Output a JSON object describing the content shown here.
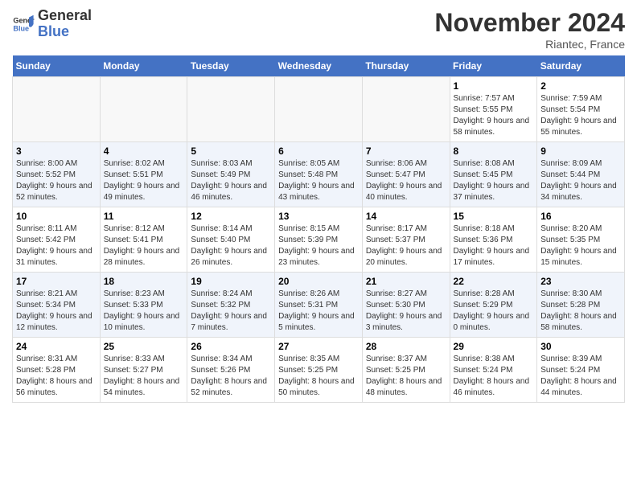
{
  "header": {
    "logo_line1": "General",
    "logo_line2": "Blue",
    "title": "November 2024",
    "subtitle": "Riantec, France"
  },
  "weekdays": [
    "Sunday",
    "Monday",
    "Tuesday",
    "Wednesday",
    "Thursday",
    "Friday",
    "Saturday"
  ],
  "weeks": [
    [
      {
        "day": "",
        "detail": ""
      },
      {
        "day": "",
        "detail": ""
      },
      {
        "day": "",
        "detail": ""
      },
      {
        "day": "",
        "detail": ""
      },
      {
        "day": "",
        "detail": ""
      },
      {
        "day": "1",
        "detail": "Sunrise: 7:57 AM\nSunset: 5:55 PM\nDaylight: 9 hours and 58 minutes."
      },
      {
        "day": "2",
        "detail": "Sunrise: 7:59 AM\nSunset: 5:54 PM\nDaylight: 9 hours and 55 minutes."
      }
    ],
    [
      {
        "day": "3",
        "detail": "Sunrise: 8:00 AM\nSunset: 5:52 PM\nDaylight: 9 hours and 52 minutes."
      },
      {
        "day": "4",
        "detail": "Sunrise: 8:02 AM\nSunset: 5:51 PM\nDaylight: 9 hours and 49 minutes."
      },
      {
        "day": "5",
        "detail": "Sunrise: 8:03 AM\nSunset: 5:49 PM\nDaylight: 9 hours and 46 minutes."
      },
      {
        "day": "6",
        "detail": "Sunrise: 8:05 AM\nSunset: 5:48 PM\nDaylight: 9 hours and 43 minutes."
      },
      {
        "day": "7",
        "detail": "Sunrise: 8:06 AM\nSunset: 5:47 PM\nDaylight: 9 hours and 40 minutes."
      },
      {
        "day": "8",
        "detail": "Sunrise: 8:08 AM\nSunset: 5:45 PM\nDaylight: 9 hours and 37 minutes."
      },
      {
        "day": "9",
        "detail": "Sunrise: 8:09 AM\nSunset: 5:44 PM\nDaylight: 9 hours and 34 minutes."
      }
    ],
    [
      {
        "day": "10",
        "detail": "Sunrise: 8:11 AM\nSunset: 5:42 PM\nDaylight: 9 hours and 31 minutes."
      },
      {
        "day": "11",
        "detail": "Sunrise: 8:12 AM\nSunset: 5:41 PM\nDaylight: 9 hours and 28 minutes."
      },
      {
        "day": "12",
        "detail": "Sunrise: 8:14 AM\nSunset: 5:40 PM\nDaylight: 9 hours and 26 minutes."
      },
      {
        "day": "13",
        "detail": "Sunrise: 8:15 AM\nSunset: 5:39 PM\nDaylight: 9 hours and 23 minutes."
      },
      {
        "day": "14",
        "detail": "Sunrise: 8:17 AM\nSunset: 5:37 PM\nDaylight: 9 hours and 20 minutes."
      },
      {
        "day": "15",
        "detail": "Sunrise: 8:18 AM\nSunset: 5:36 PM\nDaylight: 9 hours and 17 minutes."
      },
      {
        "day": "16",
        "detail": "Sunrise: 8:20 AM\nSunset: 5:35 PM\nDaylight: 9 hours and 15 minutes."
      }
    ],
    [
      {
        "day": "17",
        "detail": "Sunrise: 8:21 AM\nSunset: 5:34 PM\nDaylight: 9 hours and 12 minutes."
      },
      {
        "day": "18",
        "detail": "Sunrise: 8:23 AM\nSunset: 5:33 PM\nDaylight: 9 hours and 10 minutes."
      },
      {
        "day": "19",
        "detail": "Sunrise: 8:24 AM\nSunset: 5:32 PM\nDaylight: 9 hours and 7 minutes."
      },
      {
        "day": "20",
        "detail": "Sunrise: 8:26 AM\nSunset: 5:31 PM\nDaylight: 9 hours and 5 minutes."
      },
      {
        "day": "21",
        "detail": "Sunrise: 8:27 AM\nSunset: 5:30 PM\nDaylight: 9 hours and 3 minutes."
      },
      {
        "day": "22",
        "detail": "Sunrise: 8:28 AM\nSunset: 5:29 PM\nDaylight: 9 hours and 0 minutes."
      },
      {
        "day": "23",
        "detail": "Sunrise: 8:30 AM\nSunset: 5:28 PM\nDaylight: 8 hours and 58 minutes."
      }
    ],
    [
      {
        "day": "24",
        "detail": "Sunrise: 8:31 AM\nSunset: 5:28 PM\nDaylight: 8 hours and 56 minutes."
      },
      {
        "day": "25",
        "detail": "Sunrise: 8:33 AM\nSunset: 5:27 PM\nDaylight: 8 hours and 54 minutes."
      },
      {
        "day": "26",
        "detail": "Sunrise: 8:34 AM\nSunset: 5:26 PM\nDaylight: 8 hours and 52 minutes."
      },
      {
        "day": "27",
        "detail": "Sunrise: 8:35 AM\nSunset: 5:25 PM\nDaylight: 8 hours and 50 minutes."
      },
      {
        "day": "28",
        "detail": "Sunrise: 8:37 AM\nSunset: 5:25 PM\nDaylight: 8 hours and 48 minutes."
      },
      {
        "day": "29",
        "detail": "Sunrise: 8:38 AM\nSunset: 5:24 PM\nDaylight: 8 hours and 46 minutes."
      },
      {
        "day": "30",
        "detail": "Sunrise: 8:39 AM\nSunset: 5:24 PM\nDaylight: 8 hours and 44 minutes."
      }
    ]
  ]
}
